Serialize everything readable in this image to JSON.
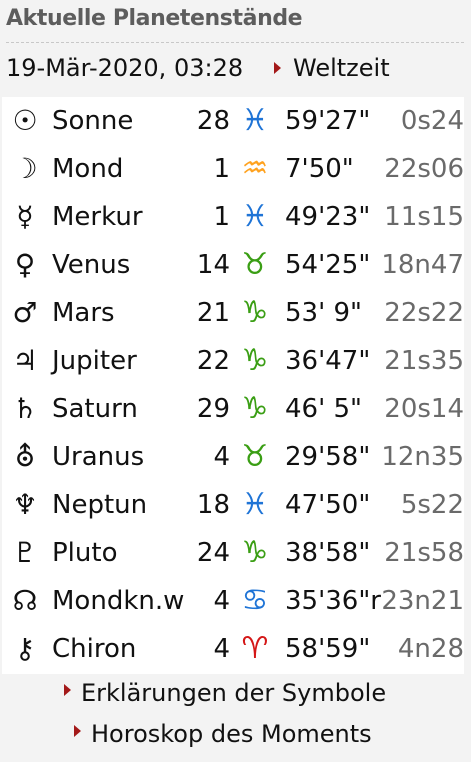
{
  "header": {
    "title": "Aktuelle Planetenstände"
  },
  "datetime": {
    "value": "19-Mär-2020, 03:28",
    "link_label": "Weltzeit"
  },
  "colors": {
    "pisces": "#1f74d6",
    "aquarius": "#ffa21f",
    "earth_sign": "#3a9e14",
    "aries": "#d41717",
    "cancer": "#1f74d6",
    "arrow": "#a31919"
  },
  "planets": [
    {
      "symbol": "☉",
      "icon": "sun-icon",
      "name": "Sonne",
      "degree": "28",
      "sign_symbol": "♓",
      "sign_icon": "pisces-icon",
      "sign_color": "#1f74d6",
      "minutes": "59'27\"",
      "speed": "0s24"
    },
    {
      "symbol": "☽",
      "icon": "moon-icon",
      "name": "Mond",
      "degree": "1",
      "sign_symbol": "♒",
      "sign_icon": "aquarius-icon",
      "sign_color": "#ffa21f",
      "minutes": "7'50\"",
      "speed": "22s06"
    },
    {
      "symbol": "☿",
      "icon": "mercury-icon",
      "name": "Merkur",
      "degree": "1",
      "sign_symbol": "♓",
      "sign_icon": "pisces-icon",
      "sign_color": "#1f74d6",
      "minutes": "49'23\"",
      "speed": "11s15"
    },
    {
      "symbol": "♀",
      "icon": "venus-icon",
      "name": "Venus",
      "degree": "14",
      "sign_symbol": "♉",
      "sign_icon": "taurus-icon",
      "sign_color": "#3a9e14",
      "minutes": "54'25\"",
      "speed": "18n47"
    },
    {
      "symbol": "♂",
      "icon": "mars-icon",
      "name": "Mars",
      "degree": "21",
      "sign_symbol": "♑",
      "sign_icon": "capricorn-icon",
      "sign_color": "#3a9e14",
      "minutes": "53' 9\"",
      "speed": "22s22"
    },
    {
      "symbol": "♃",
      "icon": "jupiter-icon",
      "name": "Jupiter",
      "degree": "22",
      "sign_symbol": "♑",
      "sign_icon": "capricorn-icon",
      "sign_color": "#3a9e14",
      "minutes": "36'47\"",
      "speed": "21s35"
    },
    {
      "symbol": "♄",
      "icon": "saturn-icon",
      "name": "Saturn",
      "degree": "29",
      "sign_symbol": "♑",
      "sign_icon": "capricorn-icon",
      "sign_color": "#3a9e14",
      "minutes": "46' 5\"",
      "speed": "20s14"
    },
    {
      "symbol": "⛢",
      "icon": "uranus-icon",
      "name": "Uranus",
      "degree": "4",
      "sign_symbol": "♉",
      "sign_icon": "taurus-icon",
      "sign_color": "#3a9e14",
      "minutes": "29'58\"",
      "speed": "12n35"
    },
    {
      "symbol": "♆",
      "icon": "neptune-icon",
      "name": "Neptun",
      "degree": "18",
      "sign_symbol": "♓",
      "sign_icon": "pisces-icon",
      "sign_color": "#1f74d6",
      "minutes": "47'50\"",
      "speed": "5s22"
    },
    {
      "symbol": "♇",
      "icon": "pluto-icon",
      "name": "Pluto",
      "degree": "24",
      "sign_symbol": "♑",
      "sign_icon": "capricorn-icon",
      "sign_color": "#3a9e14",
      "minutes": "38'58\"",
      "speed": "21s58"
    },
    {
      "symbol": "☊",
      "icon": "north-node-icon",
      "name": "Mondkn.w",
      "degree": "4",
      "sign_symbol": "♋",
      "sign_icon": "cancer-icon",
      "sign_color": "#1f74d6",
      "minutes": "35'36\"r",
      "speed": "23n21"
    },
    {
      "symbol": "⚷",
      "icon": "chiron-icon",
      "name": "Chiron",
      "degree": "4",
      "sign_symbol": "♈",
      "sign_icon": "aries-icon",
      "sign_color": "#d41717",
      "minutes": "58'59\"",
      "speed": "4n28"
    }
  ],
  "links": [
    {
      "label": "Erklärungen der Symbole"
    },
    {
      "label": "Horoskop des Moments"
    }
  ]
}
